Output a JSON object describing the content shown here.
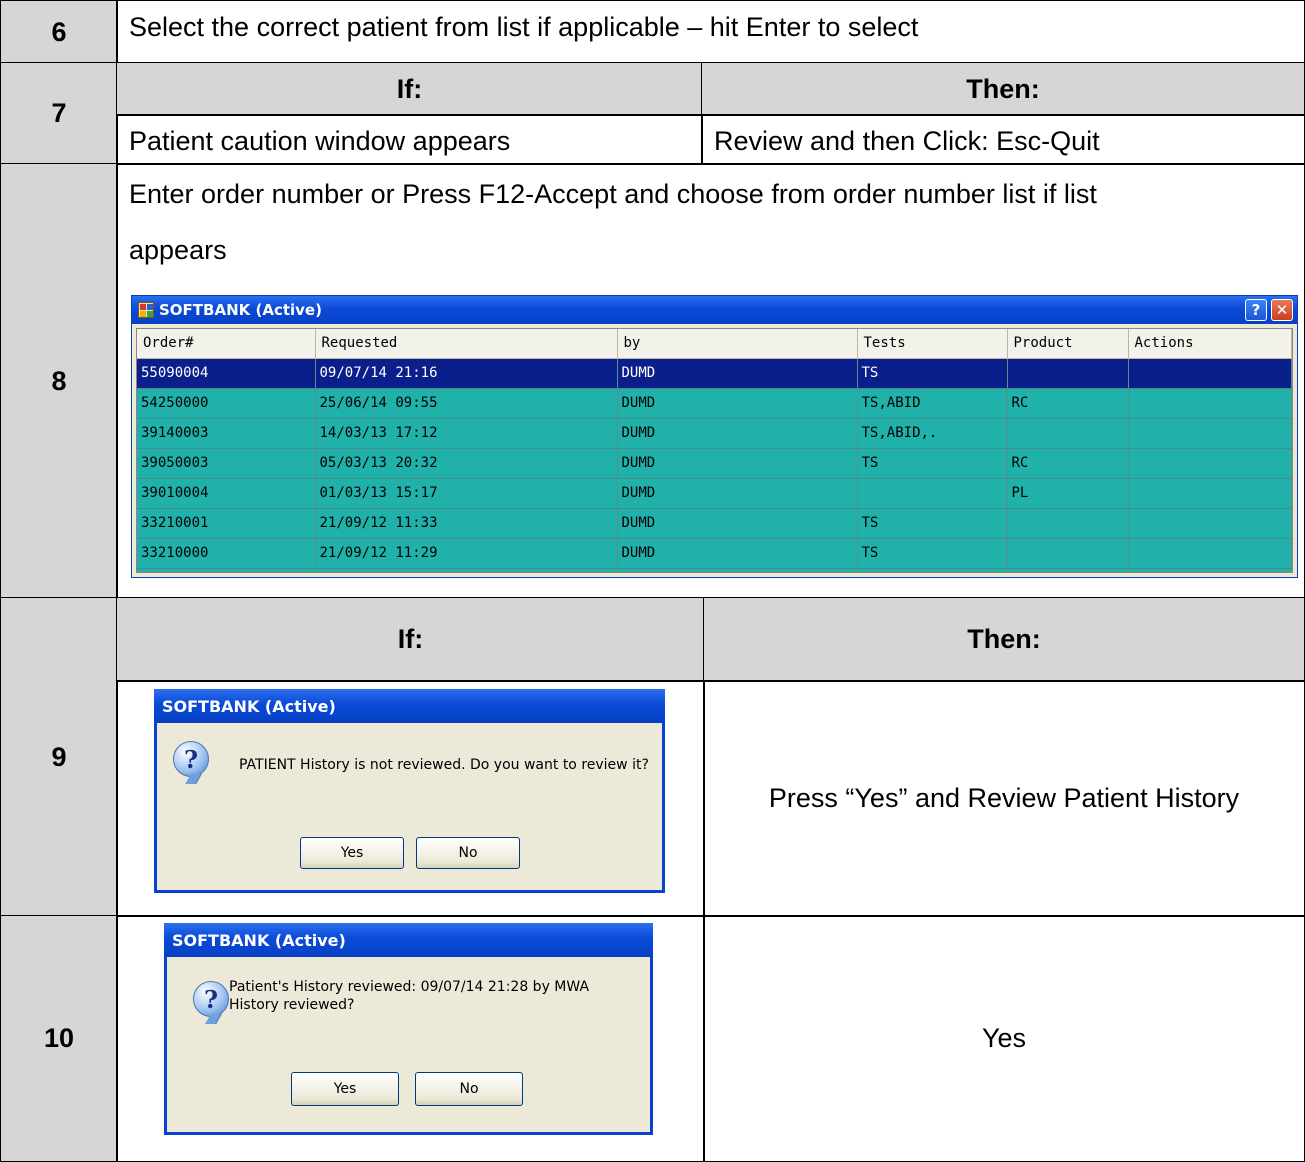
{
  "rows": {
    "r6": {
      "num": "6",
      "text": "Select the correct patient from list if applicable – hit Enter to select"
    },
    "r7": {
      "num": "7",
      "if_header": "If:",
      "then_header": "Then:",
      "if_text": "Patient caution window appears",
      "then_text": "Review and then Click: Esc-Quit"
    },
    "r8": {
      "num": "8",
      "line1": "Enter order number or Press F12-Accept and choose from order number list if list",
      "line2": "appears"
    },
    "r9": {
      "num": "9",
      "if_header": "If:",
      "then_header": "Then:",
      "then_text": "Press “Yes” and Review Patient History"
    },
    "r10": {
      "num": "10",
      "then_text": "Yes"
    }
  },
  "order_window": {
    "title": "SOFTBANK (Active)",
    "help_glyph": "?",
    "close_glyph": "✕",
    "columns": [
      "Order#",
      "Requested",
      "by",
      "Tests",
      "Product",
      "Actions"
    ],
    "rows": [
      [
        "55090004",
        "09/07/14 21:16",
        "DUMD",
        "TS",
        "",
        ""
      ],
      [
        "54250000",
        "25/06/14 09:55",
        "DUMD",
        "TS,ABID",
        "RC",
        ""
      ],
      [
        "39140003",
        "14/03/13 17:12",
        "DUMD",
        "TS,ABID,.",
        "",
        ""
      ],
      [
        "39050003",
        "05/03/13 20:32",
        "DUMD",
        "TS",
        "RC",
        ""
      ],
      [
        "39010004",
        "01/03/13 15:17",
        "DUMD",
        "",
        "PL",
        ""
      ],
      [
        "33210001",
        "21/09/12 11:33",
        "DUMD",
        "TS",
        "",
        ""
      ],
      [
        "33210000",
        "21/09/12 11:29",
        "DUMD",
        "TS",
        "",
        ""
      ]
    ],
    "selected_row": 0
  },
  "dialog1": {
    "title": "SOFTBANK (Active)",
    "icon": "question-icon",
    "message": "PATIENT History is not reviewed. Do you want to review it?",
    "yes_label": "Yes",
    "no_label": "No"
  },
  "dialog2": {
    "title": "SOFTBANK (Active)",
    "icon": "question-icon",
    "message_line1": "Patient's History reviewed: 09/07/14 21:28 by MWA",
    "message_line2": "History reviewed?",
    "yes_label": "Yes",
    "no_label": "No"
  },
  "colors": {
    "grid_bg": "#20b2aa",
    "selected_row": "#0a1f8c",
    "title_bar": "#0a4ad8",
    "number_column": "#d6d6d6"
  }
}
